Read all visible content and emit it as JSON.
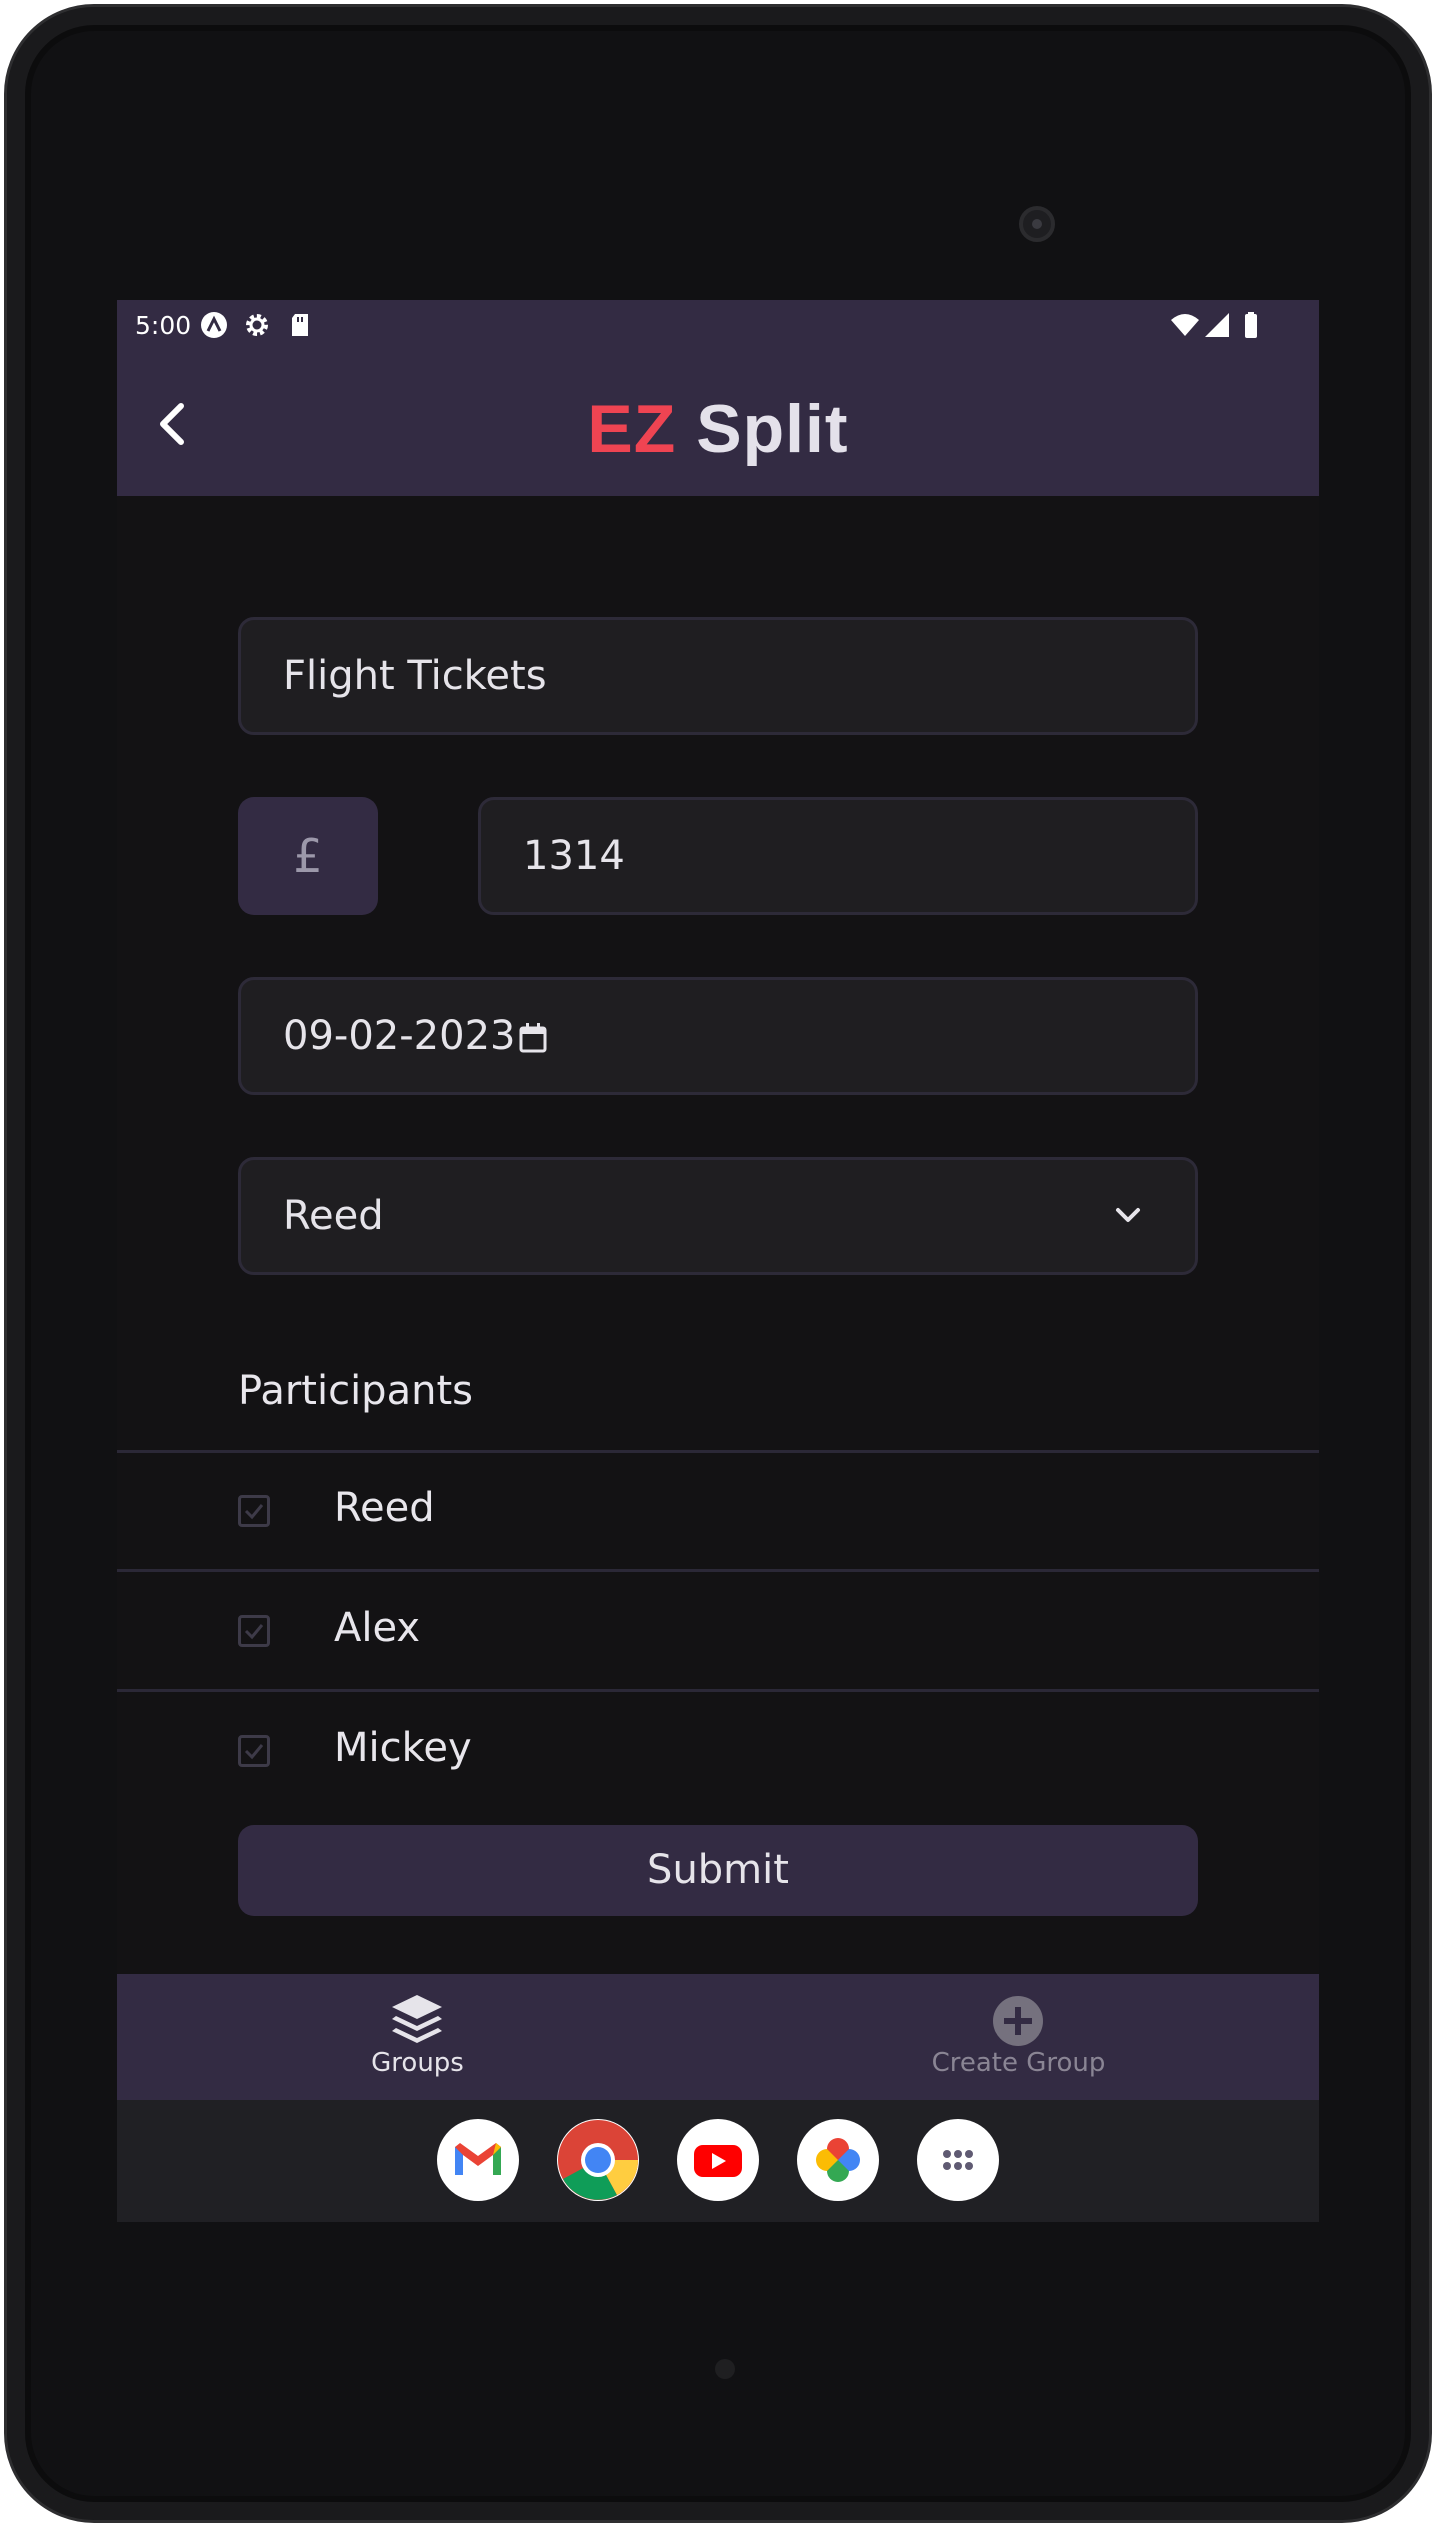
{
  "status_bar": {
    "time": "5:00",
    "left_icons": [
      "assistant-icon",
      "settings-gear-icon",
      "sd-card-icon"
    ],
    "right_icons": [
      "wifi-icon",
      "cell-signal-icon",
      "battery-icon"
    ]
  },
  "app_bar": {
    "title_accent": "EZ",
    "title_rest": "Split",
    "back_icon": "chevron-left-icon",
    "accent_color": "#ef4452",
    "bar_color": "#332b43"
  },
  "form": {
    "description_value": "Flight Tickets",
    "currency_symbol": "£",
    "amount_value": "1314",
    "date_value": "09-02-2023",
    "payer_value": "Reed"
  },
  "participants": {
    "title": "Participants",
    "items": [
      {
        "name": "Reed",
        "checked": true
      },
      {
        "name": "Alex",
        "checked": true
      },
      {
        "name": "Mickey",
        "checked": true
      }
    ]
  },
  "submit_label": "Submit",
  "bottom_nav": {
    "items": [
      {
        "label": "Groups",
        "icon": "layers-icon",
        "active": true
      },
      {
        "label": "Create Group",
        "icon": "plus-circle-icon",
        "active": false
      }
    ]
  },
  "dock": {
    "apps": [
      "gmail-icon",
      "chrome-icon",
      "youtube-icon",
      "photos-icon",
      "app-drawer-icon"
    ]
  }
}
